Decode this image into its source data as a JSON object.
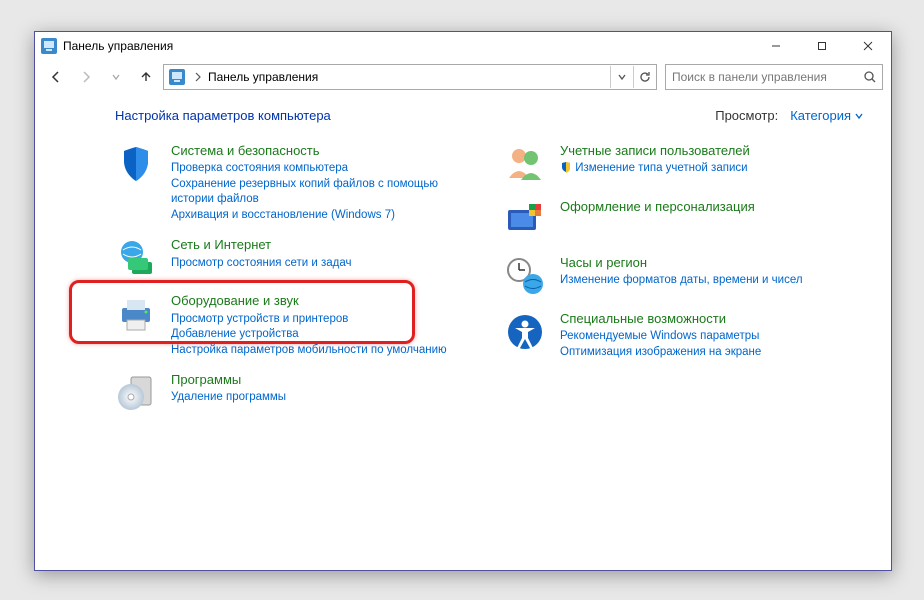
{
  "window": {
    "title": "Панель управления"
  },
  "nav": {
    "breadcrumb": "Панель управления",
    "search_placeholder": "Поиск в панели управления"
  },
  "header": {
    "title": "Настройка параметров компьютера",
    "view_label": "Просмотр:",
    "view_value": "Категория"
  },
  "categories": {
    "left": [
      {
        "key": "system",
        "title": "Система и безопасность",
        "links": [
          "Проверка состояния компьютера",
          "Сохранение резервных копий файлов с помощью истории файлов",
          "Архивация и восстановление (Windows 7)"
        ]
      },
      {
        "key": "network",
        "title": "Сеть и Интернет",
        "links": [
          "Просмотр состояния сети и задач"
        ]
      },
      {
        "key": "hardware",
        "title": "Оборудование и звук",
        "links": [
          "Просмотр устройств и принтеров",
          "Добавление устройства",
          "Настройка параметров мобильности по умолчанию"
        ]
      },
      {
        "key": "programs",
        "title": "Программы",
        "links": [
          "Удаление программы"
        ]
      }
    ],
    "right": [
      {
        "key": "accounts",
        "title": "Учетные записи пользователей",
        "links": [
          "Изменение типа учетной записи"
        ]
      },
      {
        "key": "appearance",
        "title": "Оформление и персонализация",
        "links": []
      },
      {
        "key": "clock",
        "title": "Часы и регион",
        "links": [
          "Изменение форматов даты, времени и чисел"
        ]
      },
      {
        "key": "ease",
        "title": "Специальные возможности",
        "links": [
          "Рекомендуемые Windows параметры",
          "Оптимизация изображения на экране"
        ]
      }
    ]
  }
}
